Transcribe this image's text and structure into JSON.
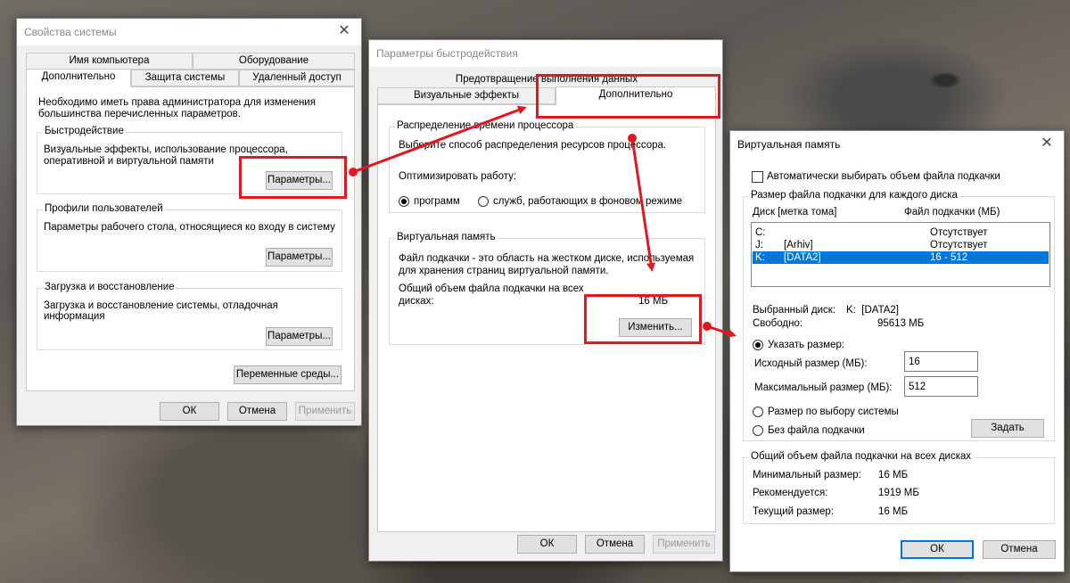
{
  "sys": {
    "title": "Свойства системы",
    "tabs_row1": [
      "Имя компьютера",
      "Оборудование"
    ],
    "tabs_row2": [
      "Дополнительно",
      "Защита системы",
      "Удаленный доступ"
    ],
    "admin_note": "Необходимо иметь права администратора для изменения большинства перечисленных параметров.",
    "perf": {
      "label": "Быстродействие",
      "desc": "Визуальные эффекты, использование процессора, оперативной и виртуальной памяти",
      "button": "Параметры..."
    },
    "profiles": {
      "label": "Профили пользователей",
      "desc": "Параметры рабочего стола, относящиеся ко входу в систему",
      "button": "Параметры..."
    },
    "startup": {
      "label": "Загрузка и восстановление",
      "desc": "Загрузка и восстановление системы, отладочная информация",
      "button": "Параметры..."
    },
    "env_button": "Переменные среды...",
    "ok": "ОК",
    "cancel": "Отмена",
    "apply": "Применить"
  },
  "perf_options": {
    "title": "Параметры быстродействия",
    "tab_dep": "Предотвращение выполнения данных",
    "tab_visual": "Визуальные эффекты",
    "tab_advanced": "Дополнительно",
    "cpu": {
      "label": "Распределение времени процессора",
      "desc": "Выберите способ распределения ресурсов процессора.",
      "optimize": "Оптимизировать работу:",
      "opt_programs": "программ",
      "opt_services": "служб, работающих в фоновом режиме"
    },
    "vm": {
      "label": "Виртуальная память",
      "desc": "Файл подкачки - это область на жестком диске, используемая для хранения страниц виртуальной памяти.",
      "total_label": "Общий объем файла подкачки на всех дисках:",
      "total_value": "16 МБ",
      "change_button": "Изменить..."
    },
    "ok": "ОК",
    "cancel": "Отмена",
    "apply": "Применить"
  },
  "vmem": {
    "title": "Виртуальная память",
    "auto_manage": "Автоматически выбирать объем файла подкачки",
    "per_drive_label": "Размер файла подкачки для каждого диска",
    "col_drive": "Диск [метка тома]",
    "col_size": "Файл подкачки (МБ)",
    "drives": [
      {
        "letter": "C:",
        "label": "",
        "size": "Отсутствует"
      },
      {
        "letter": "J:",
        "label": "[Arhiv]",
        "size": "Отсутствует"
      },
      {
        "letter": "K:",
        "label": "[DATA2]",
        "size": "16 - 512"
      }
    ],
    "selected_label": "Выбранный диск:",
    "selected_value": "K:  [DATA2]",
    "free_label": "Свободно:",
    "free_value": "95613 МБ",
    "custom_size": "Указать размер:",
    "initial_label": "Исходный размер (МБ):",
    "initial_value": "16",
    "max_label": "Максимальный размер (МБ):",
    "max_value": "512",
    "system_managed": "Размер по выбору системы",
    "no_paging": "Без файла подкачки",
    "set_button": "Задать",
    "totals_label": "Общий объем файла подкачки на всех дисках",
    "min_label": "Минимальный размер:",
    "min_value": "16 МБ",
    "rec_label": "Рекомендуется:",
    "rec_value": "1919 МБ",
    "cur_label": "Текущий размер:",
    "cur_value": "16 МБ",
    "ok": "ОК",
    "cancel": "Отмена"
  },
  "colors": {
    "highlight": "#e3171f",
    "selection": "#0078d7"
  }
}
